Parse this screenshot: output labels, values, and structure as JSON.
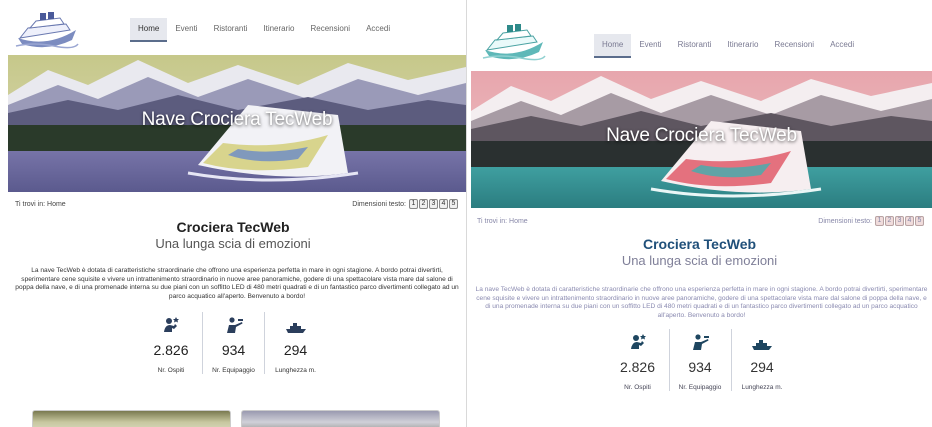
{
  "nav": {
    "items": [
      {
        "label": "Home",
        "active": true
      },
      {
        "label": "Eventi",
        "active": false
      },
      {
        "label": "Ristoranti",
        "active": false
      },
      {
        "label": "Itinerario",
        "active": false
      },
      {
        "label": "Recensioni",
        "active": false
      },
      {
        "label": "Accedi",
        "active": false
      }
    ]
  },
  "hero": {
    "title": "Nave Crociera TecWeb"
  },
  "breadcrumb": {
    "text": "Ti trovi in: Home"
  },
  "text_size": {
    "label": "Dimensioni testo:",
    "options": [
      "1",
      "2",
      "3",
      "4",
      "5"
    ]
  },
  "heading": {
    "title": "Crociera TecWeb",
    "subtitle": "Una lunga scia di emozioni"
  },
  "description": "La nave TecWeb è dotata di caratteristiche straordinarie che offrono una esperienza perfetta in mare in ogni stagione. A bordo potrai divertirti, sperimentare cene squisite e vivere un intrattenimento straordinario in nuove aree panoramiche, godere di una spettacolare vista mare dal salone di poppa della nave, e di una promenade interna su due piani con un soffitto LED di 480 metri quadrati e di un fantastico parco divertimenti collegato ad un parco acquatico all'aperto. Benvenuto a bordo!",
  "stats": [
    {
      "value": "2.826",
      "caption": "Nr. Ospiti",
      "icon": "guests-icon"
    },
    {
      "value": "934",
      "caption": "Nr. Equipaggio",
      "icon": "crew-icon"
    },
    {
      "value": "294",
      "caption": "Lunghezza m.",
      "icon": "ship-length-icon"
    }
  ],
  "colors": {
    "accent_left": "#5b6d8c",
    "heading_right": "#20507a",
    "text_right": "#8a8ab0"
  }
}
